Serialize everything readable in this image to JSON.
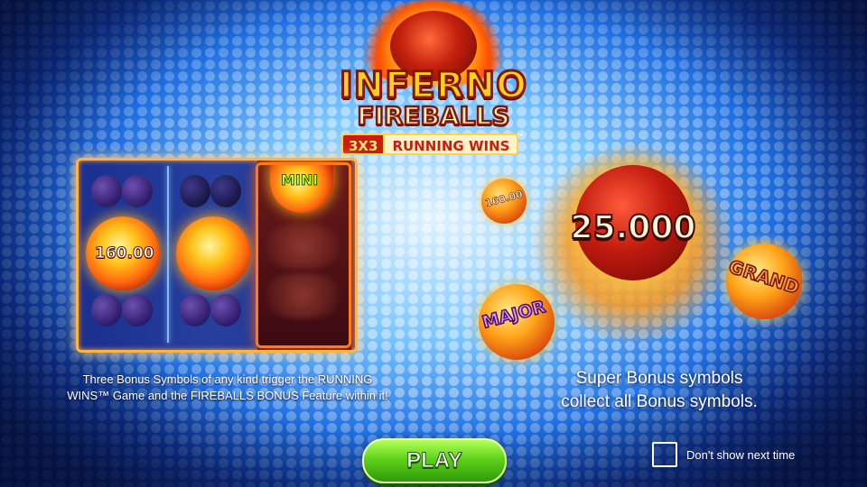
{
  "logo": {
    "title_line1": "INFERNO",
    "title_line2": "FIREBALLS",
    "tag_left": "3X3",
    "tag_right": "RUNNING WINS",
    "tm": "™"
  },
  "reels": {
    "bonus_value_left": "160.00",
    "mini_label": "MINI"
  },
  "showcase": {
    "super_value": "25.000",
    "small_value": "160.00",
    "major_label": "MAJOR",
    "grand_label": "GRAND"
  },
  "info": {
    "left_line1": "Three Bonus Symbols of any kind trigger the RUNNING",
    "left_line2": "WINS™ Game and the FIREBALLS BONUS Feature within it!",
    "right_line1": "Super Bonus symbols",
    "right_line2": "collect all Bonus symbols."
  },
  "controls": {
    "play_label": "PLAY",
    "dont_show_label": "Don't show next time"
  },
  "colors": {
    "accent_orange": "#ff7b1a",
    "play_green": "#5fd21a",
    "background_blue": "#1f6fe0"
  }
}
